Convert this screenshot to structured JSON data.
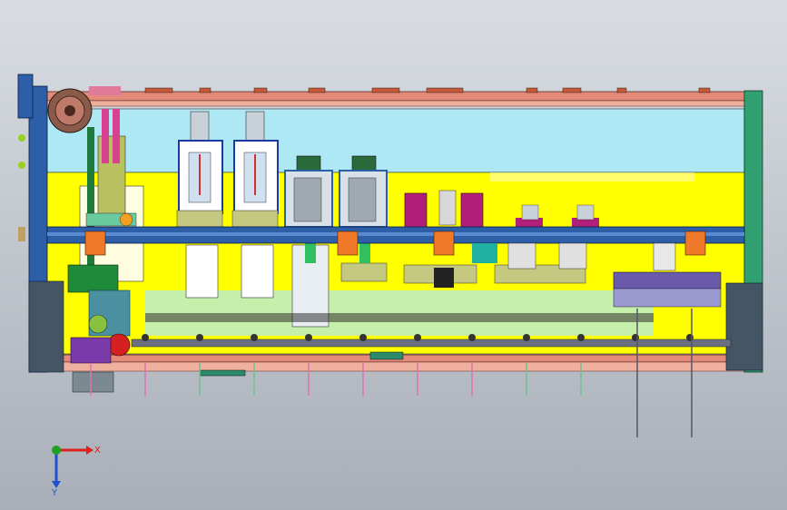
{
  "view": {
    "title": "",
    "background_top": "#d9dde3",
    "background_bottom": "#a9afb8"
  },
  "machine": {
    "frame_color": "#2d5fa8",
    "panel_color": "#ffff00",
    "upper_panel_color": "#aee8f5",
    "rail_color": "#e48a7a",
    "accent_orange": "#f07a2a",
    "accent_magenta": "#b0207a",
    "accent_green": "#22aa44"
  },
  "triad": {
    "x_label": "X",
    "y_label": "Y",
    "x_color": "#e02020",
    "y_color": "#2050d0",
    "z_color": "#20a020"
  }
}
